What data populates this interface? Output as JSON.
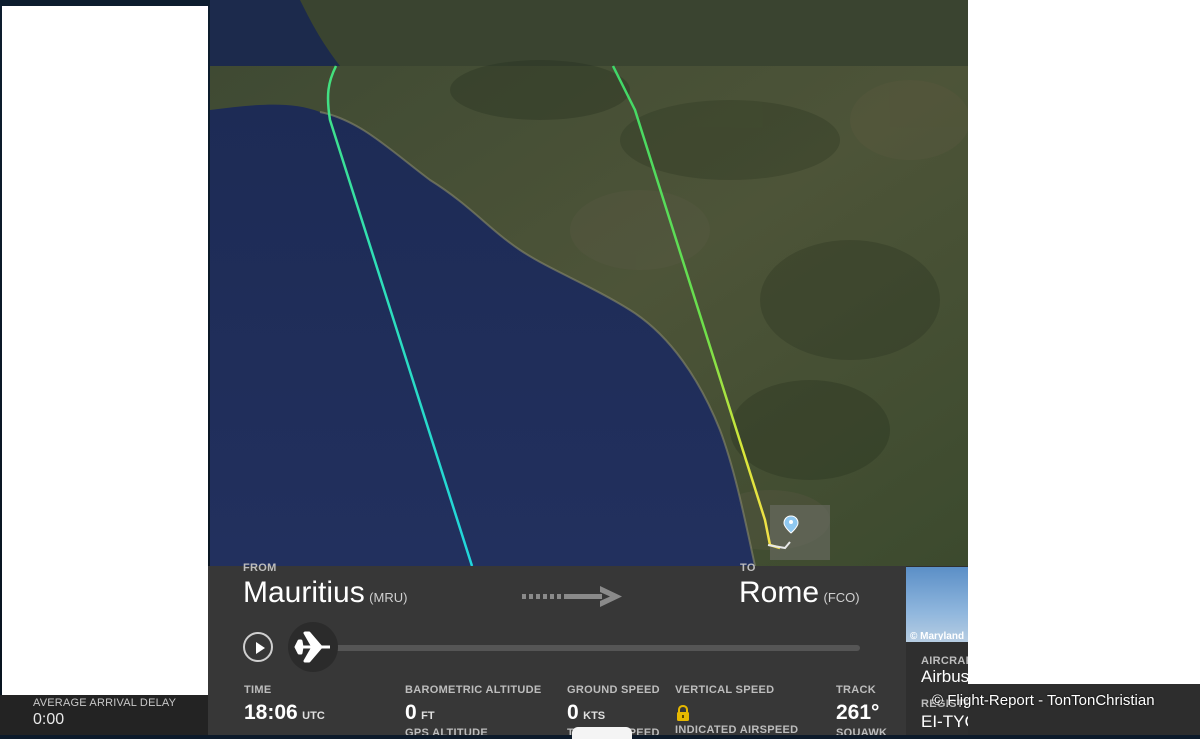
{
  "flight": {
    "from_label": "FROM",
    "from_city": "Mauritius",
    "from_code": "(MRU)",
    "to_label": "TO",
    "to_city": "Rome",
    "to_code": "(FCO)"
  },
  "metrics": {
    "time_label": "TIME",
    "time_value": "18:06",
    "time_unit": "UTC",
    "baro_label": "BAROMETRIC ALTITUDE",
    "baro_value": "0",
    "baro_unit": "FT",
    "gps_label": "GPS ALTITUDE",
    "ground_label": "GROUND SPEED",
    "ground_value": "0",
    "ground_unit": "KTS",
    "true_airspeed_label": "TRUE AIRSPEED",
    "vertical_label": "VERTICAL SPEED",
    "indicated_label": "INDICATED AIRSPEED",
    "track_label": "TRACK",
    "track_value": "261°",
    "squawk_label": "SQUAWK"
  },
  "aircraft": {
    "photo_credit": "© Maryland",
    "type_label": "AIRCRAFT",
    "type_value": "Airbus",
    "reg_label": "REGISTRATION",
    "reg_value": "EI-TYC"
  },
  "stats": {
    "avg_delay_label": "AVERAGE ARRIVAL DELAY",
    "avg_delay_value": "0:00"
  },
  "watermark": "© Flight-Report - TonTonChristian",
  "colors": {
    "path_start": "#22e0d0",
    "path_mid": "#5fe84a",
    "path_end": "#f2e03a",
    "sea": "#1e2d5c",
    "panel": "#373737"
  }
}
